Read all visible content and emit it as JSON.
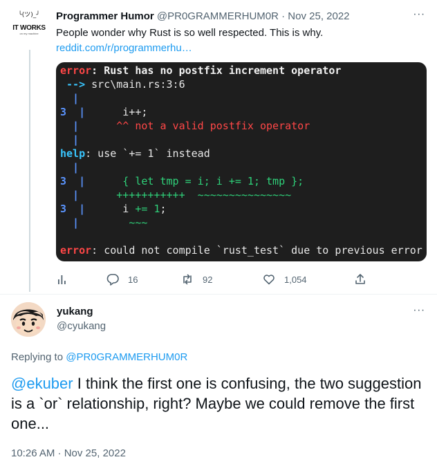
{
  "tweet1": {
    "author_name": "Programmer Humor",
    "author_handle": "@PR0GRAMMERHUM0R",
    "separator": "·",
    "date": "Nov 25, 2022",
    "text": "People wonder why Rust is so well respected. This is why.",
    "link": "reddit.com/r/programmerhu…",
    "avatar": {
      "face": "╰(ツ)_╯",
      "line1": "IT WORKS",
      "line2": "on my machine"
    },
    "code": {
      "l1_err": "error",
      "l1_msg": ": Rust has no postfix increment operator",
      "l2_arrow": " -->",
      "l2_path": " src\\main.rs:3:6",
      "gutter_bar": "  |",
      "l4_num": "3",
      "l4_code": "      i++;",
      "l5_pad": "      ",
      "l5_msg": "^^ not a valid postfix operator",
      "l7_help": "help",
      "l7_msg": ": use `+= 1` instead",
      "l9_num": "3",
      "l9_code": "      { let tmp = i; i += 1; tmp };",
      "l10_plus": "      +++++++++++",
      "l10_tilde": "  ~~~~~~~~~~~~~~~",
      "l11_num": "3",
      "l11_code_a": "      i ",
      "l11_code_b": "+= 1",
      "l11_code_c": ";",
      "l12_tilde": "        ~~~",
      "l14_err": "error",
      "l14_msg": ": could not compile `rust_test` due to previous error"
    },
    "actions": {
      "replies": "16",
      "retweets": "92",
      "likes": "1,054"
    }
  },
  "tweet2": {
    "author_name": "yukang",
    "author_handle": "@cyukang",
    "replying_prefix": "Replying to ",
    "replying_to": "@PR0GRAMMERHUM0R",
    "mention": "@ekuber",
    "text": " I think the first one is confusing, the two suggestion is a `or` relationship, right? Maybe we could remove the first one...",
    "timestamp": "10:26 AM · Nov 25, 2022"
  },
  "colors": {
    "accent": "#1d9bf0",
    "secondary_text": "#536471",
    "code_bg": "#1e1e1e",
    "code_error": "#ff4747",
    "code_green": "#2fd27a",
    "code_blue": "#5b95ff"
  }
}
